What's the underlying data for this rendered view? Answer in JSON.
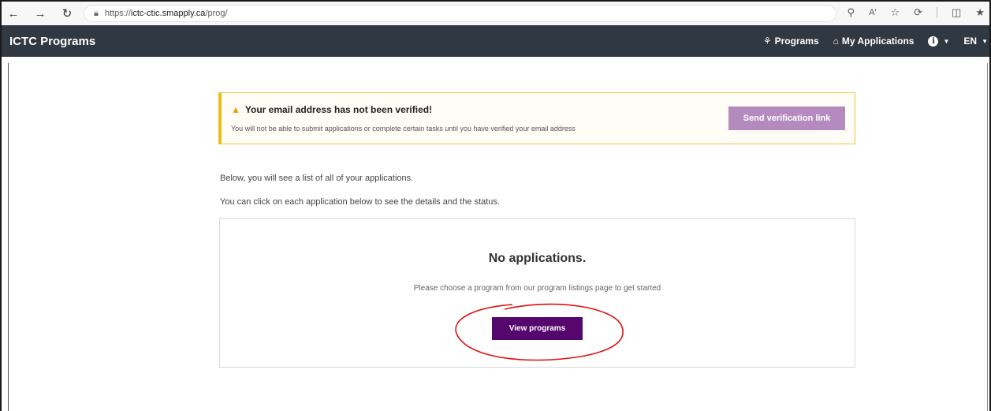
{
  "browser": {
    "url_scheme": "https://",
    "url_host": "ictc-ctic.smapply.ca",
    "url_path": "/prog/"
  },
  "header": {
    "brand": "ICTC Programs",
    "programs_label": "Programs",
    "my_applications_label": "My Applications",
    "language": "EN"
  },
  "alert": {
    "title": "Your email address has not been verified!",
    "body": "You will not be able to submit applications or complete certain tasks until you have verified your email address",
    "button_label": "Send verification link"
  },
  "intro": {
    "line1": "Below, you will see a list of all of your applications.",
    "line2": "You can click on each application below to see the details and the status."
  },
  "empty_state": {
    "title": "No applications.",
    "subtitle": "Please choose a program from our program listings page to get started",
    "button_label": "View programs"
  },
  "colors": {
    "header_bg": "#303841",
    "alert_accent": "#f0b91a",
    "verify_button": "#b58bbf",
    "primary_button": "#55076d",
    "annotation": "#e01010"
  }
}
